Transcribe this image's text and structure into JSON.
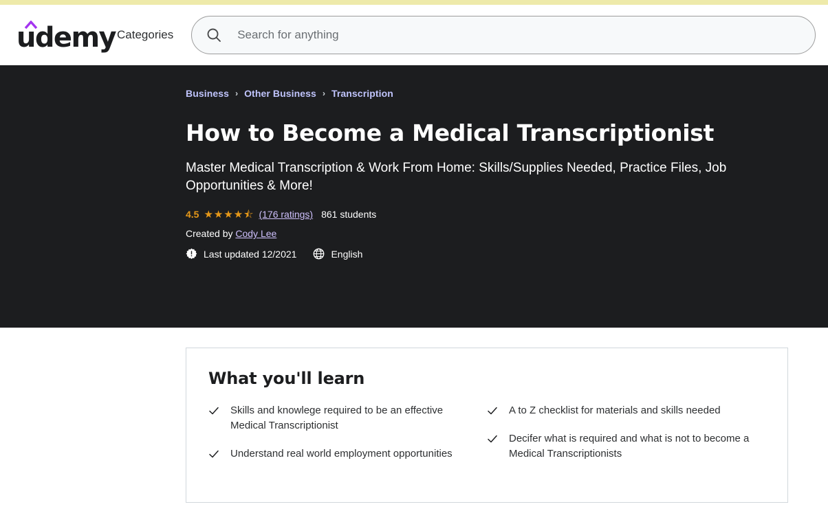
{
  "header": {
    "logo_text": "udemy",
    "logo_caret_color": "#a435f0",
    "categories_label": "Categories",
    "search_placeholder": "Search for anything",
    "search_value": ""
  },
  "hero": {
    "breadcrumb": [
      {
        "label": "Business"
      },
      {
        "label": "Other Business"
      },
      {
        "label": "Transcription"
      }
    ],
    "breadcrumb_separator": "›",
    "title": "How to Become a Medical Transcriptionist",
    "subtitle": "Master Medical Transcription & Work From Home: Skills/Supplies Needed, Practice Files, Job Opportunities & More!",
    "rating": {
      "score": "4.5",
      "stars": "★★★★",
      "half_star": "⯪",
      "ratings_link": "(176 ratings)",
      "students": "861 students"
    },
    "created_by_prefix": "Created by",
    "creator": "Cody Lee",
    "last_updated": "Last updated 12/2021",
    "language": "English",
    "accent_link_color": "#cec0fc",
    "breadcrumb_color": "#c0c4fc",
    "star_color": "#e59819",
    "background": "#1c1d1f"
  },
  "learn": {
    "title": "What you'll learn",
    "items_left": [
      "Skills and knowlege required to be an effective Medical Transcriptionist",
      "Understand real world employment opportunities"
    ],
    "items_right": [
      "A to Z checklist for materials and skills needed",
      "Decifer what is required and what is not to become a Medical Transcriptionists"
    ]
  }
}
